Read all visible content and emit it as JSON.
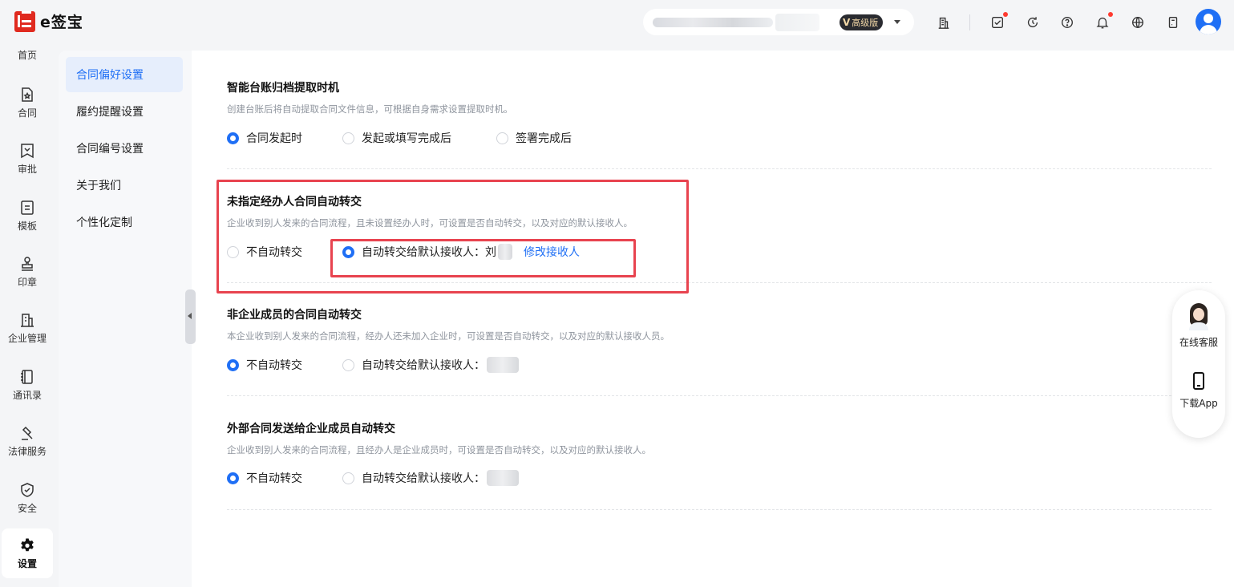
{
  "app": {
    "brand": "e签宝"
  },
  "header": {
    "org_name": "",
    "plan_badge": "高级版",
    "plan_badge_mark": "V"
  },
  "left_nav": [
    {
      "label": "首页",
      "icon": "home-icon"
    },
    {
      "label": "合同",
      "icon": "contract-icon"
    },
    {
      "label": "审批",
      "icon": "approval-icon"
    },
    {
      "label": "模板",
      "icon": "template-icon"
    },
    {
      "label": "印章",
      "icon": "seal-icon"
    },
    {
      "label": "企业管理",
      "icon": "enterprise-icon"
    },
    {
      "label": "通讯录",
      "icon": "contacts-icon"
    },
    {
      "label": "法律服务",
      "icon": "legal-service-icon"
    },
    {
      "label": "安全",
      "icon": "security-shield-icon"
    },
    {
      "label": "设置",
      "icon": "settings-gear-icon",
      "active": true
    }
  ],
  "sub_nav": [
    {
      "label": "合同偏好设置",
      "active": true
    },
    {
      "label": "履约提醒设置"
    },
    {
      "label": "合同编号设置"
    },
    {
      "label": "关于我们"
    },
    {
      "label": "个性化定制"
    }
  ],
  "sections": [
    {
      "title": "智能台账归档提取时机",
      "desc": "创建台账后将自动提取合同文件信息，可根据自身需求设置提取时机。",
      "options": [
        {
          "label": "合同发起时",
          "selected": true
        },
        {
          "label": "发起或填写完成后",
          "selected": false
        },
        {
          "label": "签署完成后",
          "selected": false
        }
      ]
    },
    {
      "title": "未指定经办人合同自动转交",
      "desc": "企业收到别人发来的合同流程，且未设置经办人时，可设置是否自动转交，以及对应的默认接收人。",
      "options": [
        {
          "label": "不自动转交",
          "selected": false
        },
        {
          "label": "自动转交给默认接收人：刘",
          "selected": true
        }
      ],
      "link": "修改接收人"
    },
    {
      "title": "非企业成员的合同自动转交",
      "desc": "本企业收到别人发来的合同流程，经办人还未加入企业时，可设置是否自动转交，以及对应的默认接收人员。",
      "options": [
        {
          "label": "不自动转交",
          "selected": true
        },
        {
          "label": "自动转交给默认接收人：",
          "selected": false
        }
      ]
    },
    {
      "title": "外部合同发送给企业成员自动转交",
      "desc": "企业收到别人发来的合同流程，且经办人是企业成员时，可设置是否自动转交，以及对应的默认接收人。",
      "options": [
        {
          "label": "不自动转交",
          "selected": true
        },
        {
          "label": "自动转交给默认接收人：",
          "selected": false
        }
      ]
    }
  ],
  "float_widget": {
    "service_label": "在线客服",
    "app_label": "下载App"
  },
  "colors": {
    "accent": "#1f6ff5",
    "highlight": "#e8434f",
    "brand_red": "#e02a1f"
  }
}
